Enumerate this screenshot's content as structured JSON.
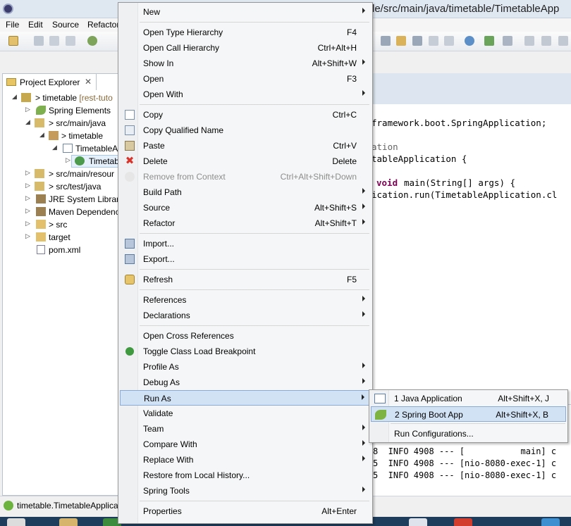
{
  "window": {
    "title": "le/src/main/java/timetable/TimetableApp"
  },
  "menubar": {
    "items": [
      "File",
      "Edit",
      "Source",
      "Refactor"
    ]
  },
  "project_explorer": {
    "tab_label": "Project Explorer",
    "tree": [
      {
        "label": "> timetable",
        "suffix": "[rest-tuto"
      },
      {
        "label": "Spring Elements"
      },
      {
        "label": "> src/main/java"
      },
      {
        "label": "> timetable"
      },
      {
        "label": "TimetableA"
      },
      {
        "label": "Timetab"
      },
      {
        "label": "> src/main/resour"
      },
      {
        "label": "> src/test/java"
      },
      {
        "label": "JRE System Library"
      },
      {
        "label": "Maven Dependenc"
      },
      {
        "label": "> src"
      },
      {
        "label": "target"
      },
      {
        "label": "pom.xml"
      }
    ]
  },
  "editor": {
    "lines": [
      "framework.boot.SpringApplication;",
      "ation",
      "tableApplication {",
      "void main(String[] args) {",
      "ication.run(TimetableApplication.cl"
    ],
    "keyword": "void"
  },
  "console": {
    "lines": [
      "8  INFO 4908 --- [           main] c",
      "5  INFO 4908 --- [nio-8080-exec-1] c",
      "5  INFO 4908 --- [nio-8080-exec-1] c"
    ]
  },
  "status": {
    "text": "timetable.TimetableApplica"
  },
  "context_menu": {
    "items": [
      {
        "label": "New",
        "shortcut": "",
        "submenu": true
      },
      {
        "label": "Open Type Hierarchy",
        "shortcut": "F4"
      },
      {
        "label": "Open Call Hierarchy",
        "shortcut": "Ctrl+Alt+H"
      },
      {
        "label": "Show In",
        "shortcut": "Alt+Shift+W",
        "submenu": true
      },
      {
        "label": "Open",
        "shortcut": "F3"
      },
      {
        "label": "Open With",
        "shortcut": "",
        "submenu": true
      },
      {
        "label": "Copy",
        "shortcut": "Ctrl+C"
      },
      {
        "label": "Copy Qualified Name",
        "shortcut": ""
      },
      {
        "label": "Paste",
        "shortcut": "Ctrl+V"
      },
      {
        "label": "Delete",
        "shortcut": "Delete"
      },
      {
        "label": "Remove from Context",
        "shortcut": "Ctrl+Alt+Shift+Down",
        "disabled": true
      },
      {
        "label": "Build Path",
        "shortcut": "",
        "submenu": true
      },
      {
        "label": "Source",
        "shortcut": "Alt+Shift+S",
        "submenu": true
      },
      {
        "label": "Refactor",
        "shortcut": "Alt+Shift+T",
        "submenu": true
      },
      {
        "label": "Import...",
        "shortcut": ""
      },
      {
        "label": "Export...",
        "shortcut": ""
      },
      {
        "label": "Refresh",
        "shortcut": "F5"
      },
      {
        "label": "References",
        "shortcut": "",
        "submenu": true
      },
      {
        "label": "Declarations",
        "shortcut": "",
        "submenu": true
      },
      {
        "label": "Open Cross References",
        "shortcut": ""
      },
      {
        "label": "Toggle Class Load Breakpoint",
        "shortcut": ""
      },
      {
        "label": "Profile As",
        "shortcut": "",
        "submenu": true
      },
      {
        "label": "Debug As",
        "shortcut": "",
        "submenu": true
      },
      {
        "label": "Run As",
        "shortcut": "",
        "submenu": true,
        "highlighted": true
      },
      {
        "label": "Validate",
        "shortcut": ""
      },
      {
        "label": "Team",
        "shortcut": "",
        "submenu": true
      },
      {
        "label": "Compare With",
        "shortcut": "",
        "submenu": true
      },
      {
        "label": "Replace With",
        "shortcut": "",
        "submenu": true
      },
      {
        "label": "Restore from Local History...",
        "shortcut": ""
      },
      {
        "label": "Spring Tools",
        "shortcut": "",
        "submenu": true
      },
      {
        "label": "Properties",
        "shortcut": "Alt+Enter"
      }
    ]
  },
  "run_as_submenu": {
    "items": [
      {
        "label": "1 Java Application",
        "shortcut": "Alt+Shift+X, J"
      },
      {
        "label": "2 Spring Boot App",
        "shortcut": "Alt+Shift+X, B",
        "highlighted": true
      },
      {
        "label": "Run Configurations...",
        "shortcut": ""
      }
    ]
  },
  "colors": {
    "highlight": "#d2e2f5",
    "highlight_border": "#8aa9d3",
    "spring_green": "#6db33f",
    "delete_red": "#d9342b",
    "keyword": "#7f0055"
  }
}
